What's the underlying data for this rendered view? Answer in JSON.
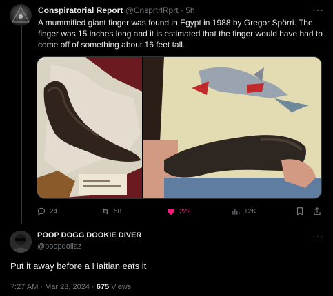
{
  "tweet": {
    "author_name": "Conspiratorial Report",
    "handle": "@CnsprtrlRprt",
    "separator": "·",
    "time": "5h",
    "more": "···",
    "text": "A mummified giant finger was found in Egypt in 1988 by Gregor Spörri. The finger was 15 inches long and it is estimated that the finger would have had to come off of something about 16 feet tall.",
    "stats": {
      "replies": "24",
      "reposts": "58",
      "likes": "222",
      "views": "12K"
    },
    "like_color": "#f91880"
  },
  "reply": {
    "author_name": "POOP DOGG DOOKIE DIVER",
    "handle": "@poopdollaz",
    "more": "···",
    "text": "Put it away before a Haitian eats it",
    "timestamp": "7:27 AM · Mar 23, 2024 · ",
    "views_count": "675",
    "views_label": " Views"
  },
  "icons": {
    "reply": "reply-icon",
    "repost": "repost-icon",
    "like": "heart-icon",
    "views": "views-chart-icon",
    "bookmark": "bookmark-icon",
    "share": "share-icon"
  },
  "colors": {
    "background": "#000000",
    "text": "#e7e9ea",
    "muted": "#71767b",
    "divider": "#2f3336"
  }
}
